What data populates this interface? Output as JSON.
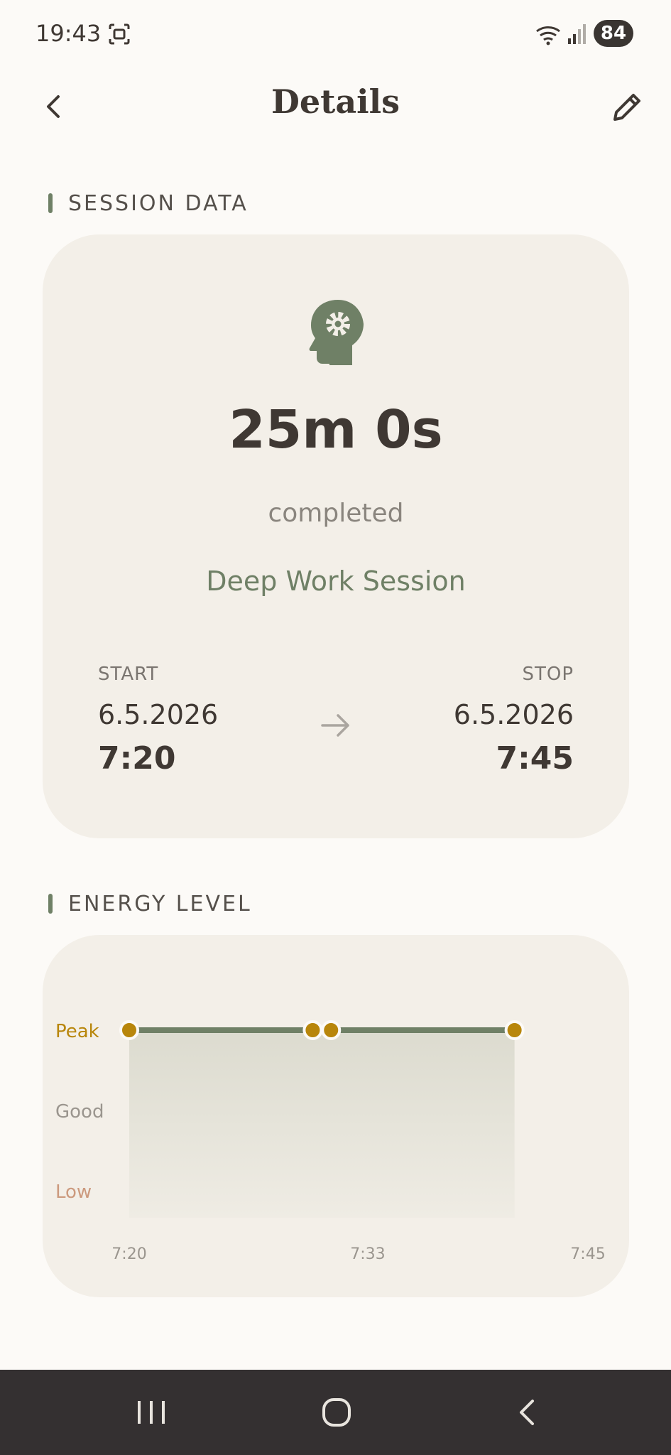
{
  "status_bar": {
    "time": "19:43",
    "battery": "84"
  },
  "header": {
    "title": "Details"
  },
  "session": {
    "section_label": "SESSION DATA",
    "duration": "25m 0s",
    "status": "completed",
    "name": "Deep Work Session",
    "start_label": "START",
    "start_date": "6.5.2026",
    "start_time": "7:20",
    "stop_label": "STOP",
    "stop_date": "6.5.2026",
    "stop_time": "7:45"
  },
  "energy": {
    "section_label": "ENERGY LEVEL"
  },
  "colors": {
    "accent": "#6f8066",
    "peak": "#b8860b",
    "good": "#9a958e",
    "low": "#cc9a7e",
    "card": "#f3efe8",
    "background": "#fcfaf7"
  },
  "chart_data": {
    "type": "line",
    "y_levels": [
      "Low",
      "Good",
      "Peak"
    ],
    "x_ticks": [
      "7:20",
      "7:33",
      "7:45"
    ],
    "xlim": [
      "7:20",
      "7:45"
    ],
    "points": [
      {
        "x": "7:20",
        "y": "Peak"
      },
      {
        "x": "7:30",
        "y": "Peak"
      },
      {
        "x": "7:31",
        "y": "Peak"
      },
      {
        "x": "7:41",
        "y": "Peak"
      }
    ],
    "grid": false,
    "legend": "none"
  }
}
